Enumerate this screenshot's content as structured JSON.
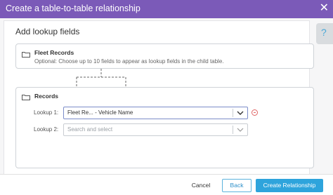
{
  "dialog": {
    "title": "Create a table-to-table relationship",
    "close_glyph": "✕",
    "help_glyph": "?"
  },
  "main": {
    "section_title": "Add lookup fields",
    "parent_card": {
      "title": "Fleet Records",
      "subtitle": "Optional: Choose up to 10 fields to appear as lookup fields in the child table."
    },
    "child_card": {
      "title": "Records",
      "lookups": [
        {
          "label": "Lookup 1:",
          "value": "Fleet Re... - Vehicle Name",
          "placeholder": ""
        },
        {
          "label": "Lookup 2:",
          "value": "",
          "placeholder": "Search and select"
        }
      ]
    }
  },
  "footer": {
    "cancel_label": "Cancel",
    "back_label": "Back",
    "create_label": "Create Relationship"
  },
  "colors": {
    "titlebar": "#7b5ab8",
    "primary_button": "#2ea4dc",
    "remove_icon": "#e06666"
  }
}
